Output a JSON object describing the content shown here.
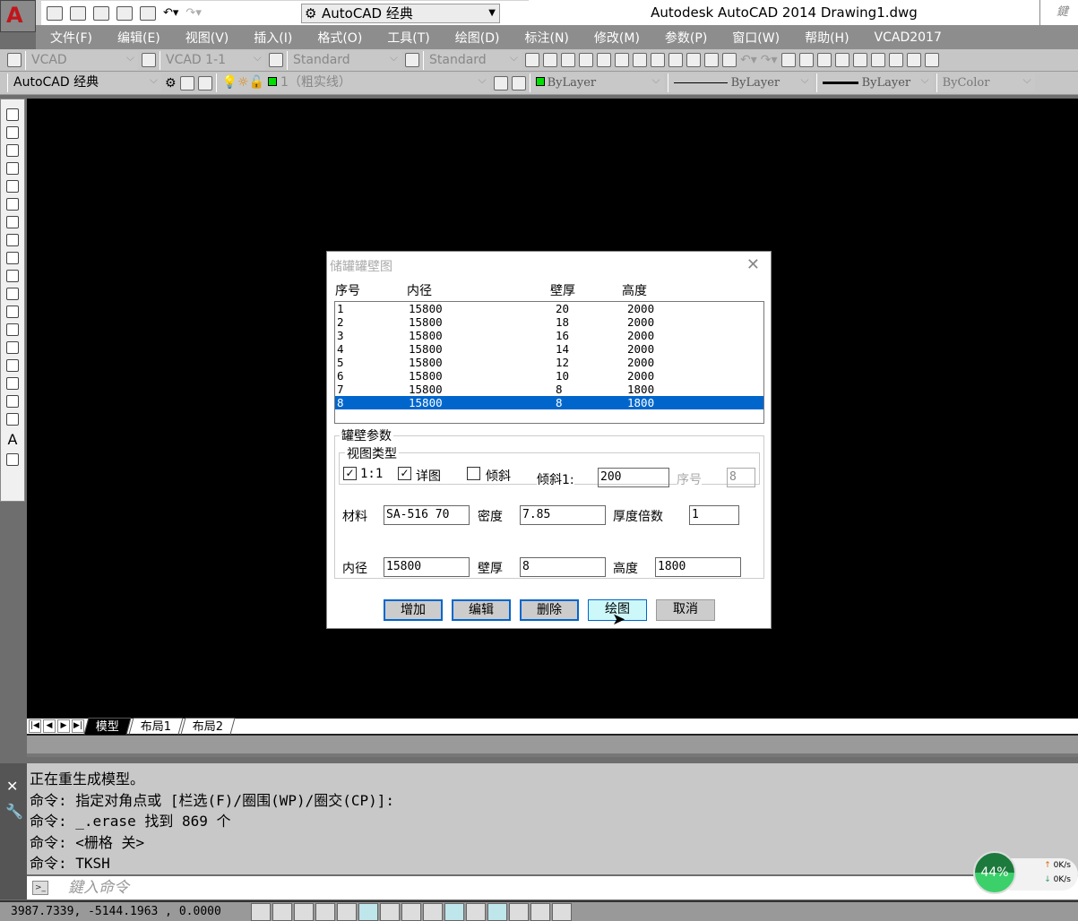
{
  "titlebar": {
    "workspace": "AutoCAD 经典",
    "title": "Autodesk AutoCAD 2014    Drawing1.dwg",
    "search_placeholder": "鍵入"
  },
  "menu": [
    "文件(F)",
    "编辑(E)",
    "视图(V)",
    "插入(I)",
    "格式(O)",
    "工具(T)",
    "绘图(D)",
    "标注(N)",
    "修改(M)",
    "参数(P)",
    "窗口(W)",
    "帮助(H)",
    "VCAD2017"
  ],
  "toolbar1": {
    "text_style": "VCAD",
    "dim_style": "VCAD 1-1",
    "table_style": "Standard",
    "mleader_style": "Standard"
  },
  "toolbar2": {
    "workspace": "AutoCAD 经典",
    "layer": "1（粗实线）",
    "color": "ByLayer",
    "linetype": "ByLayer",
    "lineweight": "ByLayer",
    "plotstyle": "ByColor"
  },
  "layout_tabs": [
    "模型",
    "布局1",
    "布局2"
  ],
  "command_history": [
    "正在重生成模型。",
    "命令: 指定对角点或 [栏选(F)/圈围(WP)/圈交(CP)]:",
    "命令: _.erase 找到 869 个",
    "命令:  <栅格 关>",
    "命令: TKSH"
  ],
  "command_placeholder": "鍵入命令",
  "coords": "3987.7339,   -5144.1963 , 0.0000",
  "network": {
    "percent": "44%",
    "up": "0K/s",
    "down": "0K/s"
  },
  "dialog": {
    "title": "储罐罐壁图",
    "columns": [
      "序号",
      "内径",
      "壁厚",
      "高度"
    ],
    "rows": [
      [
        "1",
        "15800",
        "20",
        "2000"
      ],
      [
        "2",
        "15800",
        "18",
        "2000"
      ],
      [
        "3",
        "15800",
        "16",
        "2000"
      ],
      [
        "4",
        "15800",
        "14",
        "2000"
      ],
      [
        "5",
        "15800",
        "12",
        "2000"
      ],
      [
        "6",
        "15800",
        "10",
        "2000"
      ],
      [
        "7",
        "15800",
        "8",
        "1800"
      ],
      [
        "8",
        "15800",
        "8",
        "1800"
      ]
    ],
    "selected_row": 8,
    "group_params": "罐壁参数",
    "group_view": "视图类型",
    "chk_1to1": "1:1",
    "chk_detail": "详图",
    "chk_tilt": "倾斜",
    "tilt_label": "倾斜1:",
    "tilt_value": "200",
    "seq_label": "序号",
    "seq_value": "8",
    "material_label": "材料",
    "material_value": "SA-516 70",
    "density_label": "密度",
    "density_value": "7.85",
    "thick_factor_label": "厚度倍数",
    "thick_factor_value": "1",
    "diameter_label": "内径",
    "diameter_value": "15800",
    "wall_label": "壁厚",
    "wall_value": "8",
    "height_label": "高度",
    "height_value": "1800",
    "buttons": {
      "add": "增加",
      "edit": "编辑",
      "delete": "删除",
      "draw": "绘图",
      "cancel": "取消"
    }
  }
}
